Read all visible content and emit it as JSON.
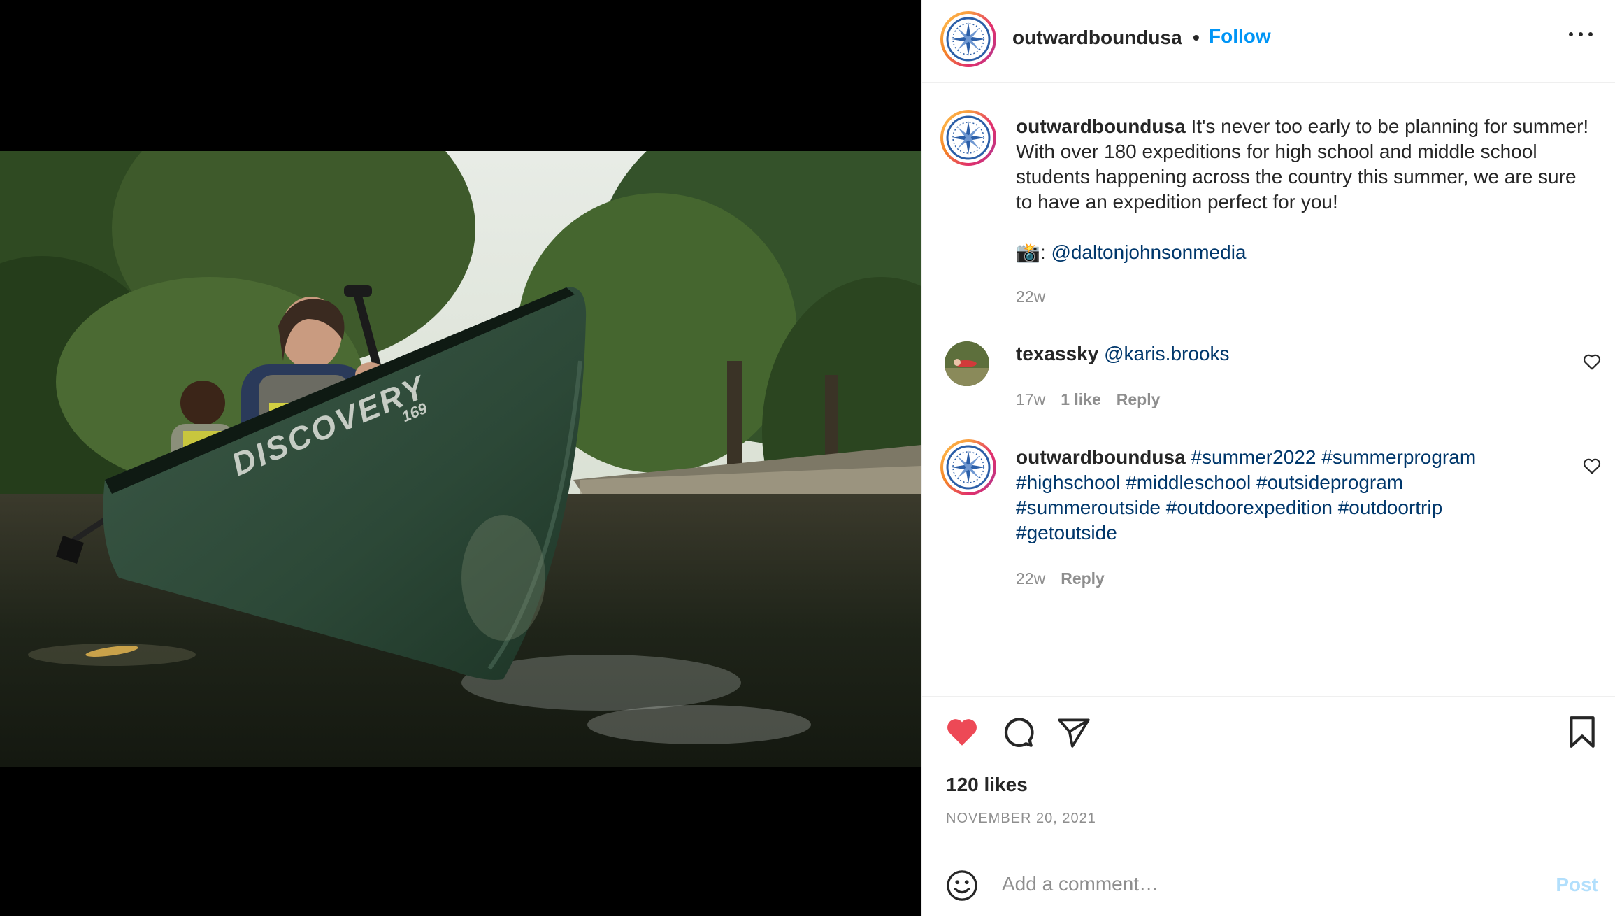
{
  "post": {
    "media_alt": "Two girls paddling a green Discovery canoe on a river",
    "canoe_brand_text": "DISCOVERY",
    "canoe_model_text": "169"
  },
  "header": {
    "username": "outwardboundusa",
    "separator": "•",
    "follow_label": "Follow",
    "more_icon": "more-horizontal-icon"
  },
  "caption": {
    "username": "outwardboundusa",
    "text": "It's never too early to be planning for summer! With over 180 expeditions for high school and middle school students happening across the country this summer, we are sure to have an expedition perfect for you!",
    "credit_emoji": "📸:",
    "credit_mention": "@daltonjohnsonmedia",
    "age": "22w"
  },
  "comments": [
    {
      "username": "texassky",
      "mention": "@karis.brooks",
      "age": "17w",
      "likes": "1 like",
      "reply_label": "Reply"
    },
    {
      "username": "outwardboundusa",
      "hashtags_line1": "#summer2022 #summerprogram",
      "hashtags_line2": "#highschool #middleschool #outsideprogram",
      "hashtags_line3": "#summeroutside #outdoorexpedition #outdoortrip",
      "hashtags_line4": "#getoutside",
      "age": "22w",
      "reply_label": "Reply"
    }
  ],
  "actions": {
    "liked": true,
    "like_color": "#ed4956",
    "likes_count": "120 likes",
    "date": "NOVEMBER 20, 2021"
  },
  "comment_box": {
    "placeholder": "Add a comment…",
    "post_label": "Post",
    "post_color": "#b2dffc"
  },
  "colors": {
    "link": "#00376b",
    "follow": "#0095f6",
    "meta": "#8e8e8e"
  }
}
